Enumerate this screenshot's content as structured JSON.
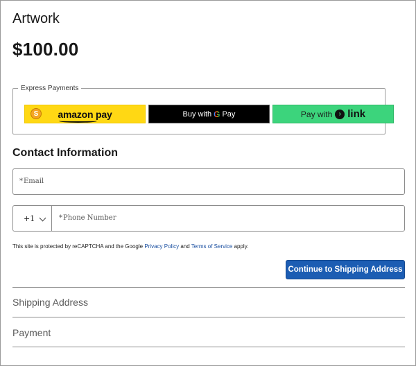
{
  "product": {
    "title": "Artwork",
    "price": "$100.00"
  },
  "express_payments": {
    "legend": "Express Payments",
    "amazon": {
      "logo": "S",
      "label": "amazon pay"
    },
    "gpay": {
      "prefix": "Buy with",
      "g": "G",
      "suffix": "Pay"
    },
    "link": {
      "prefix": "Pay with",
      "icon": "›",
      "word": "link"
    }
  },
  "contact": {
    "title": "Contact Information",
    "email": {
      "required": "*",
      "placeholder": "Email"
    },
    "country_code": "+1",
    "phone": {
      "required": "*",
      "placeholder": "Phone Number"
    }
  },
  "recaptcha": {
    "text_before": "This site is protected by reCAPTCHA and the Google ",
    "privacy_link": "Privacy Policy",
    "and": " and ",
    "terms_link": "Terms of Service",
    "text_after": " apply."
  },
  "continue_button": "Continue to Shipping Address",
  "sections": {
    "shipping": "Shipping Address",
    "payment": "Payment"
  },
  "colors": {
    "primary_button": "#1c5db3",
    "amazon_yellow": "#ffd814",
    "link_green": "#3cd47c"
  }
}
